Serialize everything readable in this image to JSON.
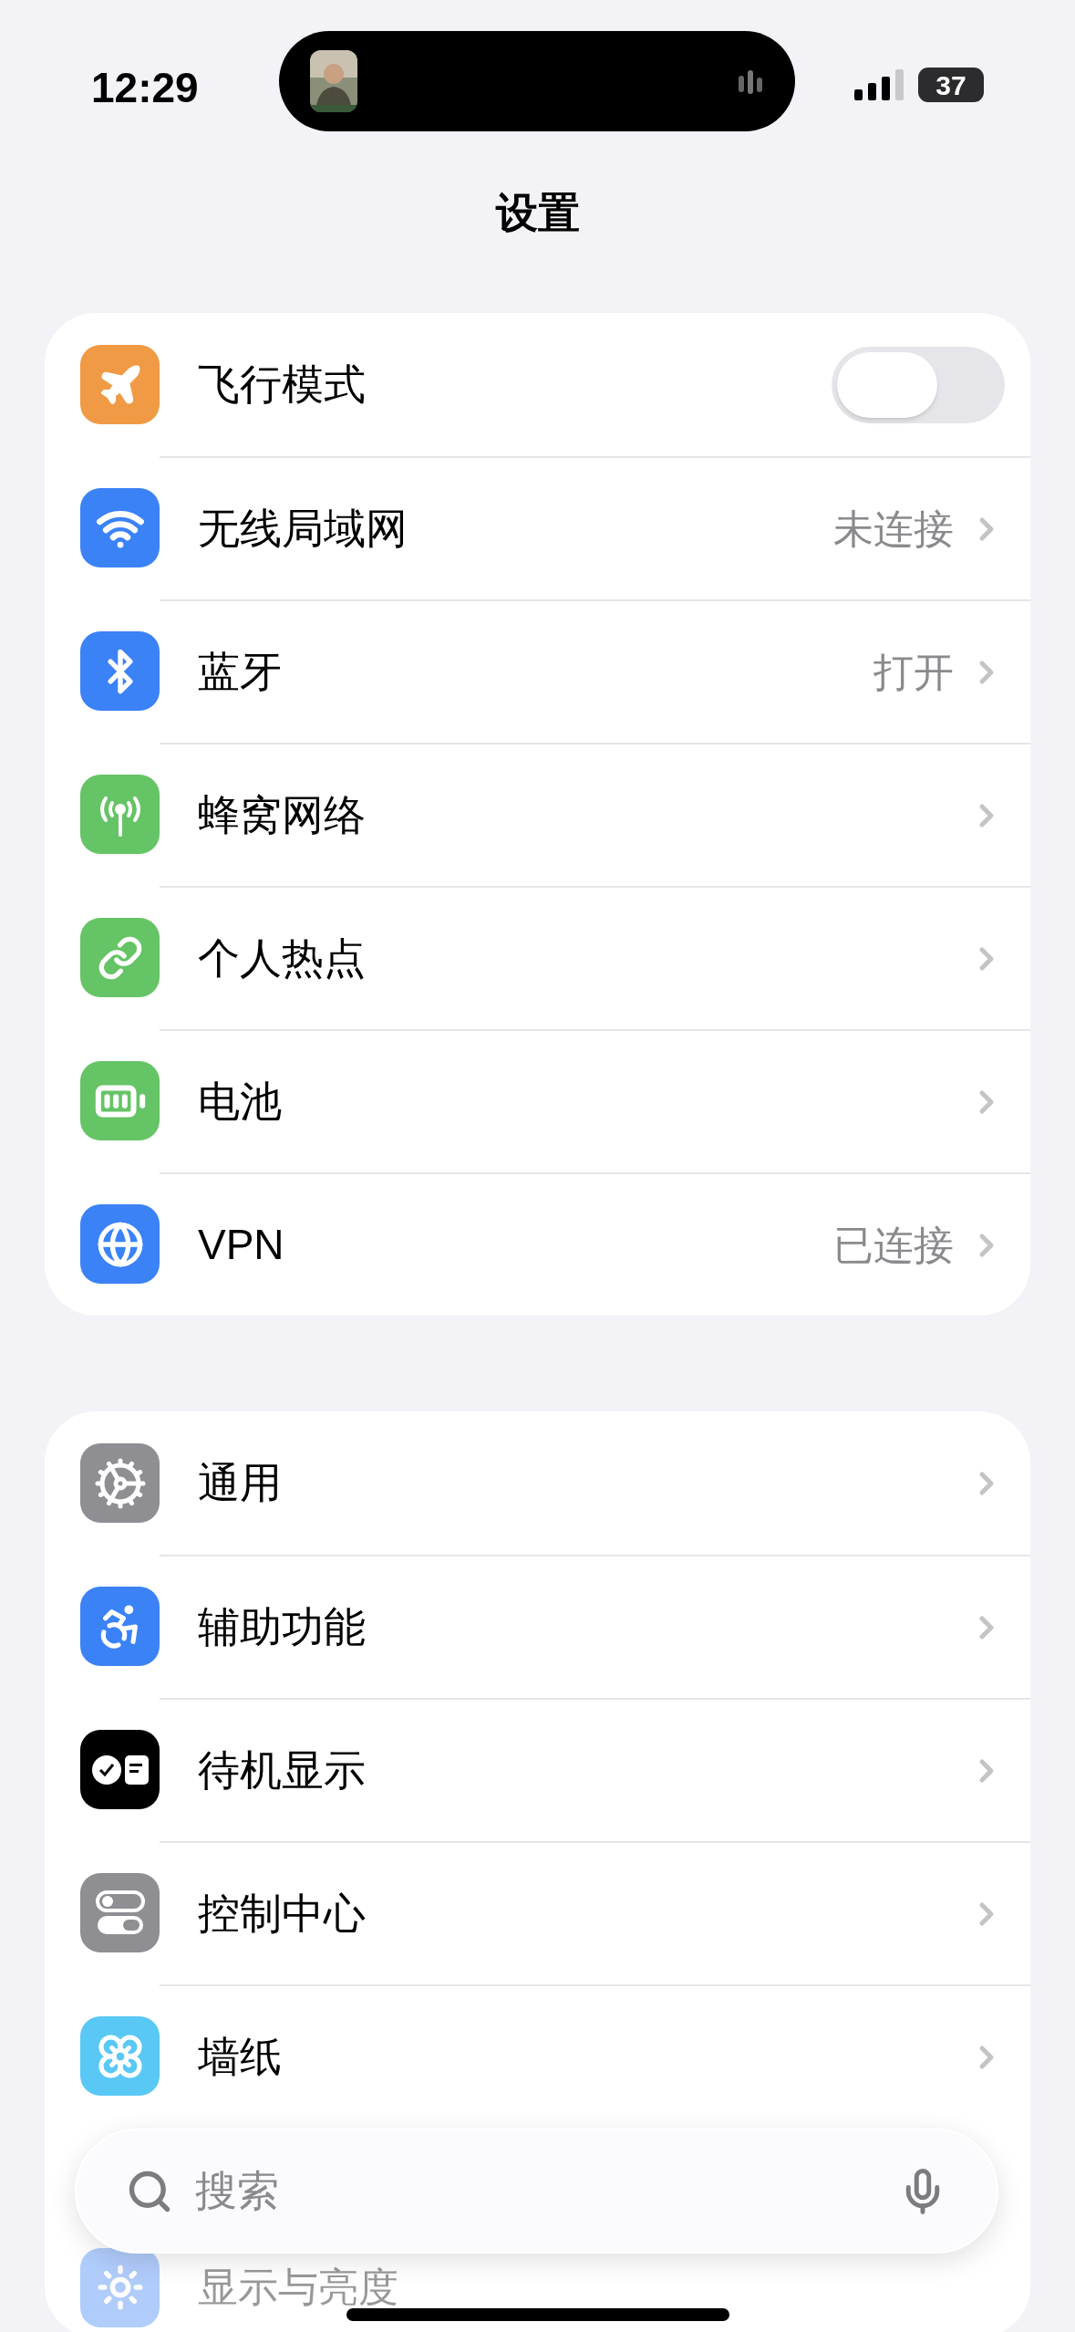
{
  "status_bar": {
    "time": "12:29",
    "battery": "37"
  },
  "title": "设置",
  "groups": [
    {
      "rows": [
        {
          "kind": "toggle",
          "label": "飞行模式",
          "on": false
        },
        {
          "kind": "link",
          "label": "无线局域网",
          "value": "未连接"
        },
        {
          "kind": "link",
          "label": "蓝牙",
          "value": "打开"
        },
        {
          "kind": "link",
          "label": "蜂窝网络"
        },
        {
          "kind": "link",
          "label": "个人热点"
        },
        {
          "kind": "link",
          "label": "电池"
        },
        {
          "kind": "link",
          "label": "VPN",
          "value": "已连接"
        }
      ]
    },
    {
      "rows": [
        {
          "kind": "link",
          "label": "通用"
        },
        {
          "kind": "link",
          "label": "辅助功能"
        },
        {
          "kind": "link",
          "label": "待机显示"
        },
        {
          "kind": "link",
          "label": "控制中心"
        },
        {
          "kind": "link",
          "label": "墙纸"
        }
      ]
    }
  ],
  "partial_row": {
    "label": "显示与亮度"
  },
  "search": {
    "placeholder": "搜索"
  }
}
